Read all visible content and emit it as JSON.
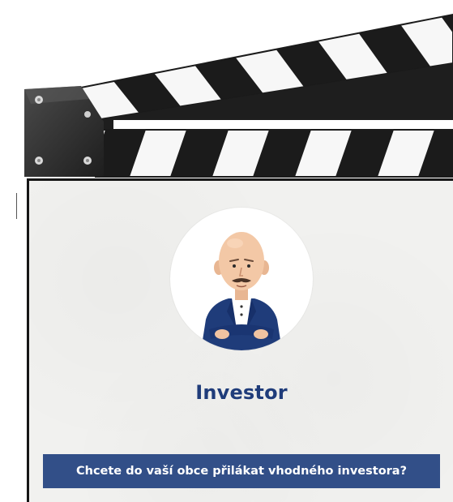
{
  "card": {
    "title": "Investor",
    "tagline": "Chcete do vaší obce přilákat vhodného investora?",
    "avatar_icon": "investor-avatar-icon",
    "colors": {
      "title": "#1f3c7a",
      "banner_bg": "#324f88",
      "banner_text": "#ffffff",
      "slate_bg": "#f1f1ef",
      "clapper_black": "#1b1b1b"
    }
  }
}
